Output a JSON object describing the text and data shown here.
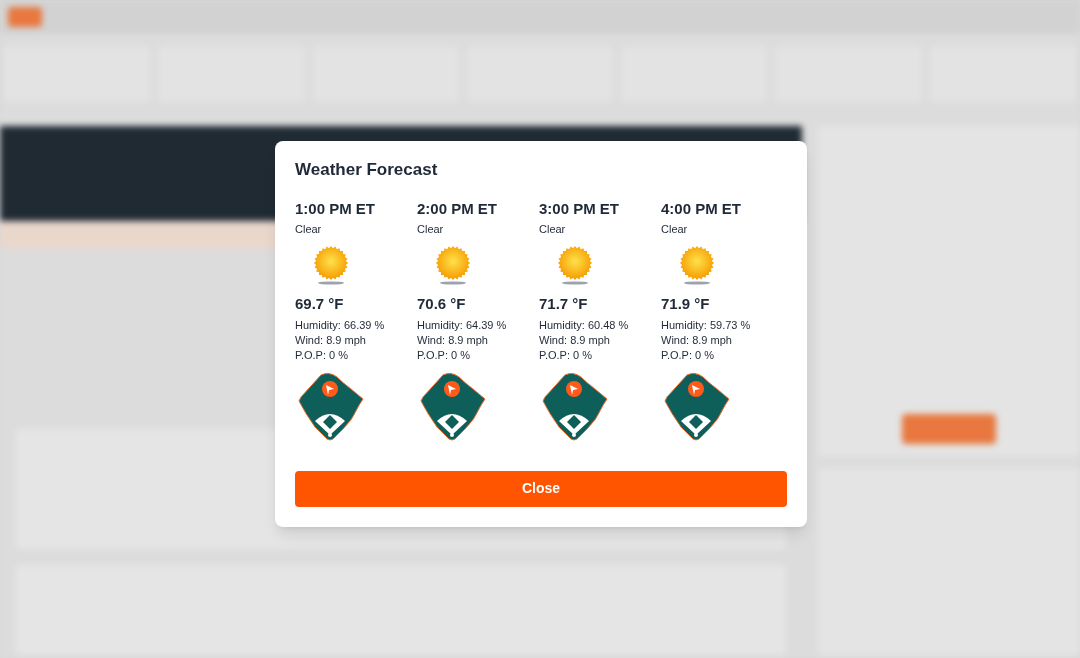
{
  "modal": {
    "title": "Weather Forecast",
    "forecasts": [
      {
        "time": "1:00 PM ET",
        "condition": "Clear",
        "temperature": "69.7 °F",
        "humidity": "Humidity: 66.39 %",
        "wind": "Wind: 8.9 mph",
        "pop": "P.O.P: 0 %"
      },
      {
        "time": "2:00 PM ET",
        "condition": "Clear",
        "temperature": "70.6 °F",
        "humidity": "Humidity: 64.39 %",
        "wind": "Wind: 8.9 mph",
        "pop": "P.O.P: 0 %"
      },
      {
        "time": "3:00 PM ET",
        "condition": "Clear",
        "temperature": "71.7 °F",
        "humidity": "Humidity: 60.48 %",
        "wind": "Wind: 8.9 mph",
        "pop": "P.O.P: 0 %"
      },
      {
        "time": "4:00 PM ET",
        "condition": "Clear",
        "temperature": "71.9 °F",
        "humidity": "Humidity: 59.73 %",
        "wind": "Wind: 8.9 mph",
        "pop": "P.O.P: 0 %"
      }
    ],
    "close_button": "Close"
  }
}
